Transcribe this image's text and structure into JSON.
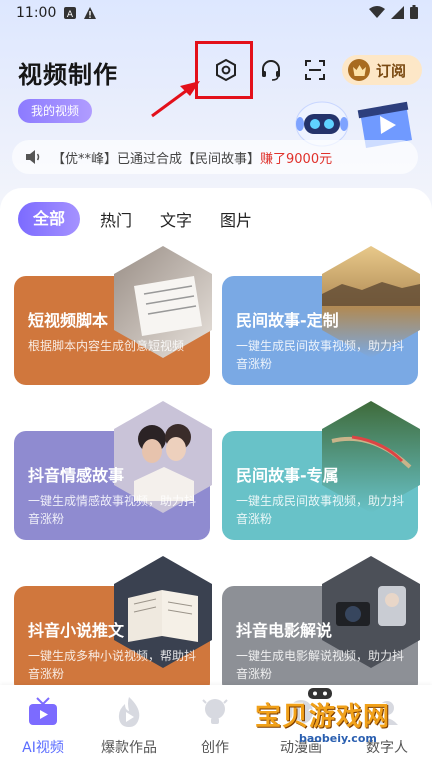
{
  "status_bar": {
    "time": "11:00"
  },
  "header": {
    "title": "视频制作",
    "my_videos_label": "我的视频",
    "subscribe_label": "订阅"
  },
  "ticker": {
    "prefix": "【优**峰】已通过合成【民间故事】",
    "highlight": "赚了9000元"
  },
  "tabs": [
    "全部",
    "热门",
    "文字",
    "图片"
  ],
  "cards": [
    {
      "title": "短视频脚本",
      "desc": "根据脚本内容生成创意短视频",
      "color": "#d0773d"
    },
    {
      "title": "民间故事-定制",
      "desc": "一键生成民间故事视频，助力抖音涨粉",
      "color": "#7aa9e4"
    },
    {
      "title": "抖音情感故事",
      "desc": "一键生成情感故事视频，助力抖音涨粉",
      "color": "#8f8bd0"
    },
    {
      "title": "民间故事-专属",
      "desc": "一键生成民间故事视频，助力抖音涨粉",
      "color": "#68c2c8"
    },
    {
      "title": "抖音小说推文",
      "desc": "一键生成多种小说视频，帮助抖音涨粉",
      "color": "#d0773d"
    },
    {
      "title": "抖音电影解说",
      "desc": "一键生成电影解说视频，助力抖音涨粉",
      "color": "#8d9096"
    }
  ],
  "bottom_nav": [
    "AI视频",
    "爆款作品",
    "创作",
    "动漫画",
    "数字人"
  ],
  "watermark": {
    "text": "宝贝游戏网",
    "url": "baobeiy.com"
  },
  "colors": {
    "accent": "#7c6bff",
    "highlight": "#e3101a"
  }
}
